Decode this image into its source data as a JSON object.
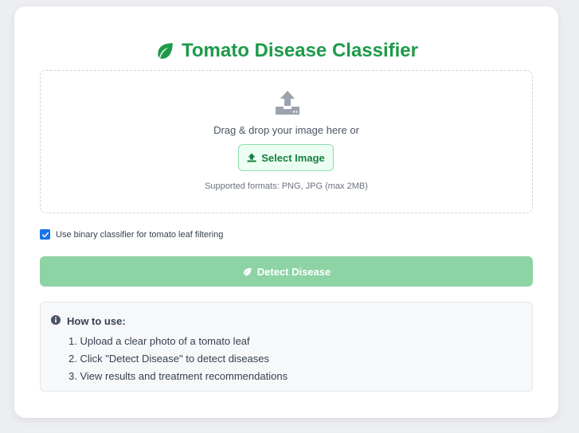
{
  "app": {
    "title": "Tomato Disease Classifier",
    "accent_color": "#1e9a4a"
  },
  "upload": {
    "icon": "upload-icon",
    "drag_text": "Drag & drop your image here or",
    "select_button_label": "Select Image",
    "formats_text": "Supported formats: PNG, JPG (max 2MB)"
  },
  "options": {
    "binary_classifier_label": "Use binary classifier for tomato leaf filtering",
    "binary_classifier_checked": true
  },
  "actions": {
    "detect_button_label": "Detect Disease",
    "detect_button_color": "#8dd3a4"
  },
  "instructions": {
    "heading": "How to use:",
    "steps": [
      "1. Upload a clear photo of a tomato leaf",
      "2. Click \"Detect Disease\" to detect diseases",
      "3. View results and treatment recommendations"
    ]
  }
}
